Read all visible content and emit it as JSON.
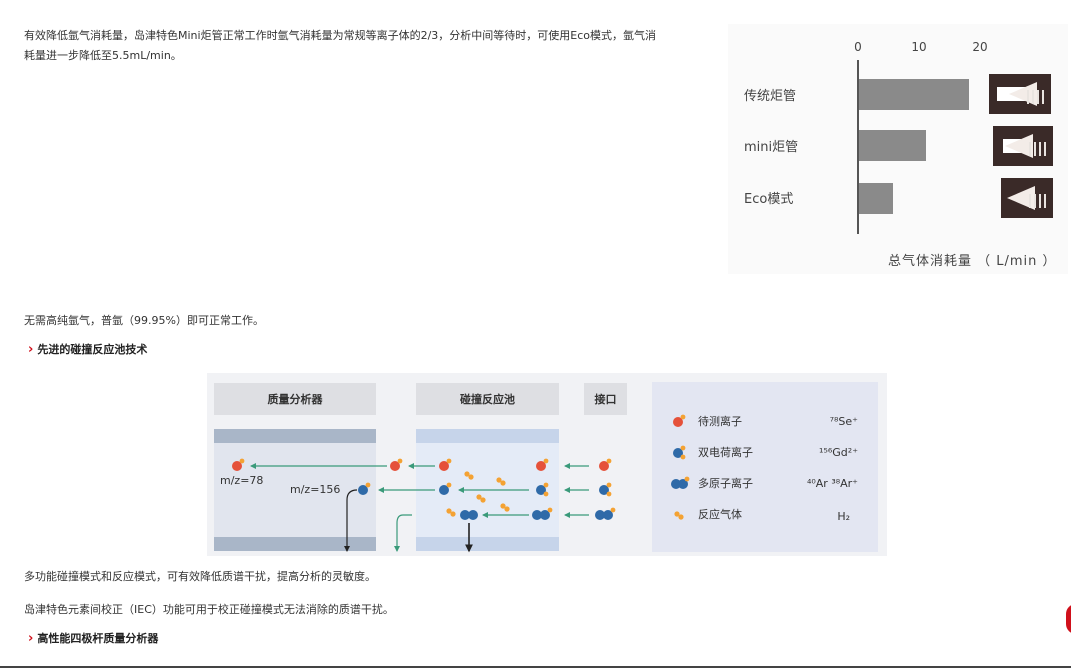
{
  "paragraphs": {
    "p1_line1": "有效降低氩气消耗量，岛津特色Mini炬管正常工作时氩气消耗量为常规等离子体的2/3，分析中间等待时，可使用Eco模式，氩气消",
    "p1_line2": "耗量进一步降低至5.5mL/min。",
    "p2": "无需高纯氩气，普氩（99.95%）即可正常工作。",
    "p3": "多功能碰撞模式和反应模式，可有效降低质谱干扰，提高分析的灵敏度。",
    "p4": "岛津特色元素间校正（IEC）功能可用于校正碰撞模式无法消除的质谱干扰。"
  },
  "headings": {
    "h1": "先进的碰撞反应池技术",
    "h2": "高性能四极杆质量分析器"
  },
  "icons": {
    "section_marker": "chevron-right-icon"
  },
  "colors": {
    "accent": "#d0101b",
    "bar": "#8a8a8a",
    "ion_red": "#e5513a",
    "ion_blue": "#2f6aa8",
    "gas": "#f4a233",
    "arrow_green": "#3a9a7a"
  },
  "chart_data": {
    "type": "bar",
    "orientation": "horizontal",
    "categories": [
      "传统炬管",
      "mini炬管",
      "Eco模式"
    ],
    "values": [
      18,
      11,
      5.5
    ],
    "xlim": [
      0,
      20
    ],
    "xticks": [
      "0",
      "10",
      "20"
    ],
    "xlabel": "总气体消耗量 （ L/min ）",
    "grid": false
  },
  "diagram": {
    "headers": [
      "质量分析器",
      "碰撞反应池",
      "接口"
    ],
    "labels": {
      "mz78": "m/z=78",
      "mz156": "m/z=156"
    },
    "legend": [
      {
        "label": "待测离子",
        "formula": "⁷⁸Se⁺"
      },
      {
        "label": "双电荷离子",
        "formula": "¹⁵⁶Gd²⁺"
      },
      {
        "label": "多原子离子",
        "formula": "⁴⁰Ar ³⁸Ar⁺"
      },
      {
        "label": "反应气体",
        "formula": "H₂"
      }
    ]
  }
}
